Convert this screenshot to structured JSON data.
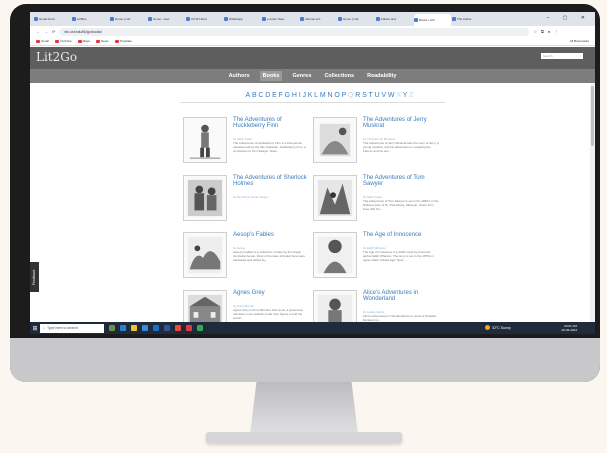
{
  "browser": {
    "tabs": [
      {
        "label": "Gmail Inbox",
        "active": false
      },
      {
        "label": "eOffice",
        "active": false
      },
      {
        "label": "Home | Lit2",
        "active": false
      },
      {
        "label": "Home - Goo",
        "active": false
      },
      {
        "label": "ICTM Librar",
        "active": false
      },
      {
        "label": "WhatsApp",
        "active": false
      },
      {
        "label": "e-Gram Swa",
        "active": false
      },
      {
        "label": "Internet Arc",
        "active": false
      },
      {
        "label": "Home | Lit2",
        "active": false
      },
      {
        "label": "Fables and",
        "active": false
      },
      {
        "label": "Books | Lit2",
        "active": true
      },
      {
        "label": "The Author",
        "active": false
      }
    ],
    "window_controls": "– ▢ ✕",
    "url": "etc.usf.edu/lit2go/books/",
    "bookmarks": [
      "Gmail",
      "YouTube",
      "Maps",
      "News",
      "Translate"
    ],
    "all_bookmarks": "All Bookmarks"
  },
  "site": {
    "logo": "Lit2Go",
    "search_placeholder": "Search",
    "nav": [
      "Authors",
      "Books",
      "Genres",
      "Collections",
      "Readability"
    ],
    "current_nav": "Books",
    "alphabet": [
      "A",
      "B",
      "C",
      "D",
      "E",
      "F",
      "G",
      "H",
      "I",
      "J",
      "K",
      "L",
      "M",
      "N",
      "O",
      "P",
      "Q",
      "R",
      "S",
      "T",
      "U",
      "V",
      "W",
      "X",
      "Y",
      "Z"
    ],
    "dim_letters": [
      "Q",
      "X",
      "Z"
    ],
    "feedback": "Feedback"
  },
  "books": [
    {
      "title": "The Adventures of Huckleberry Finn",
      "author": "by Mark Twain",
      "desc": "The Adventures of Huckleberry Finn is a first-person narrative told by the title character, Huckleberry Finn, a companion to Tom Sawyer. Huck..."
    },
    {
      "title": "The Adventures of Jerry Muskrat",
      "author": "by Thornton W. Burgess",
      "desc": "The Adventures of Jerry Muskrat tells the story of Jerry, a young muskrat, and his adventures in escaping the Farmer and his son..."
    },
    {
      "title": "The Adventures of Sherlock Holmes",
      "author": "by Sir Arthur Conan Doyle",
      "desc": ""
    },
    {
      "title": "The Adventures of Tom Sawyer",
      "author": "by Mark Twain",
      "desc": "The Adventures of Tom Sawyer is set in the 1840's in the fictitious town of St. Petersburg, Missouri, where Tom lives with his..."
    },
    {
      "title": "Aesop's Fables",
      "author": "by Aesop",
      "desc": "Aesop's Fables is a collection of tales by the Greek storyteller Aesop. Most of the tales included here were translated and edited by..."
    },
    {
      "title": "The Age of Innocence",
      "author": "by Edith Wharton",
      "desc": "The Age of Innocence is a 1920 novel by American author Edith Wharton. The story is set in the 1870s in upper-class \"Gilded Age\" New..."
    },
    {
      "title": "Agnes Grey",
      "author": "by Anne Brontë",
      "desc": "Agnes Grey is Anne Brontë's first novel, a governess narrative in the realistic mode from Agnes to find the social..."
    },
    {
      "title": "Alice's Adventures in Wonderland",
      "author": "by Lewis Carroll",
      "desc": "Alice's Adventures in Wonderland is a novel of fantastic literature by..."
    }
  ],
  "taskbar": {
    "search_placeholder": "Type here to search",
    "weather": "32°C Sunny",
    "time": "03:01 PM",
    "date": "06-06-2024",
    "lang": "ENG"
  }
}
